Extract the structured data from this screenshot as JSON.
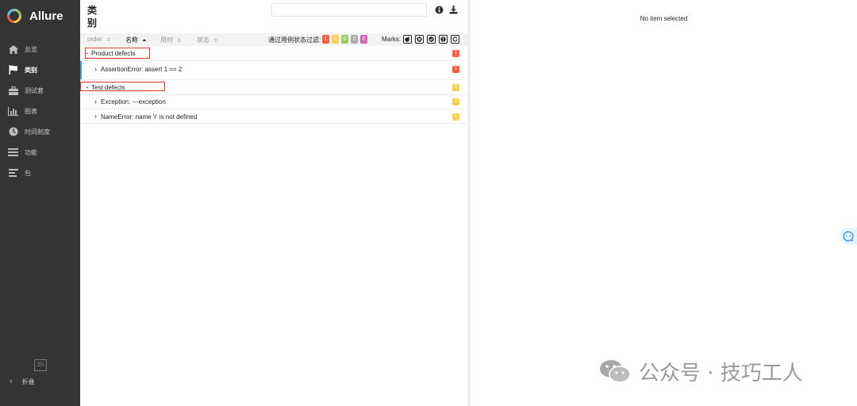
{
  "app": {
    "name": "Allure",
    "logo_icon": "allure-logo-icon"
  },
  "sidebar": {
    "items": [
      {
        "label": "总览",
        "icon": "home-icon",
        "active": false
      },
      {
        "label": "类别",
        "icon": "flag-icon",
        "active": true
      },
      {
        "label": "测试套",
        "icon": "briefcase-icon",
        "active": false
      },
      {
        "label": "图表",
        "icon": "bar-chart-icon",
        "active": false
      },
      {
        "label": "时间刻度",
        "icon": "clock-icon",
        "active": false
      },
      {
        "label": "功能",
        "icon": "list-icon",
        "active": false
      },
      {
        "label": "包",
        "icon": "align-left-icon",
        "active": false
      }
    ],
    "language": "Zh",
    "collapse_label": "折叠"
  },
  "main": {
    "title": "类别",
    "search": {
      "value": "",
      "placeholder": ""
    },
    "columns": {
      "order": "order",
      "name": "名称",
      "duration": "用时",
      "status": "状态"
    },
    "filter": {
      "label": "通过用例状态过滤:",
      "badges": [
        {
          "value": "1",
          "color": "#fd5a3e"
        },
        {
          "value": "2",
          "color": "#ffd050"
        },
        {
          "value": "0",
          "color": "#97cc64"
        },
        {
          "value": "0",
          "color": "#aaaaaa"
        },
        {
          "value": "0",
          "color": "#d35ebe"
        }
      ]
    },
    "marks_label": "Marks:",
    "groups": [
      {
        "name": "Product defects",
        "count": "1",
        "color": "#fd5a3e",
        "items": [
          {
            "name": "AssertionError: assert 1 == 2",
            "count": "1"
          }
        ]
      },
      {
        "name": "Test defects",
        "count": "2",
        "color": "#ffd050",
        "items": [
          {
            "name": "Exception: ---exception",
            "count": "1"
          },
          {
            "name": "NameError: name 'r' is not defined",
            "count": "1"
          }
        ]
      }
    ]
  },
  "detail": {
    "empty_text": "No item selected"
  },
  "watermark": {
    "text": "公众号 · 技巧工人",
    "icon": "wechat-icon"
  }
}
